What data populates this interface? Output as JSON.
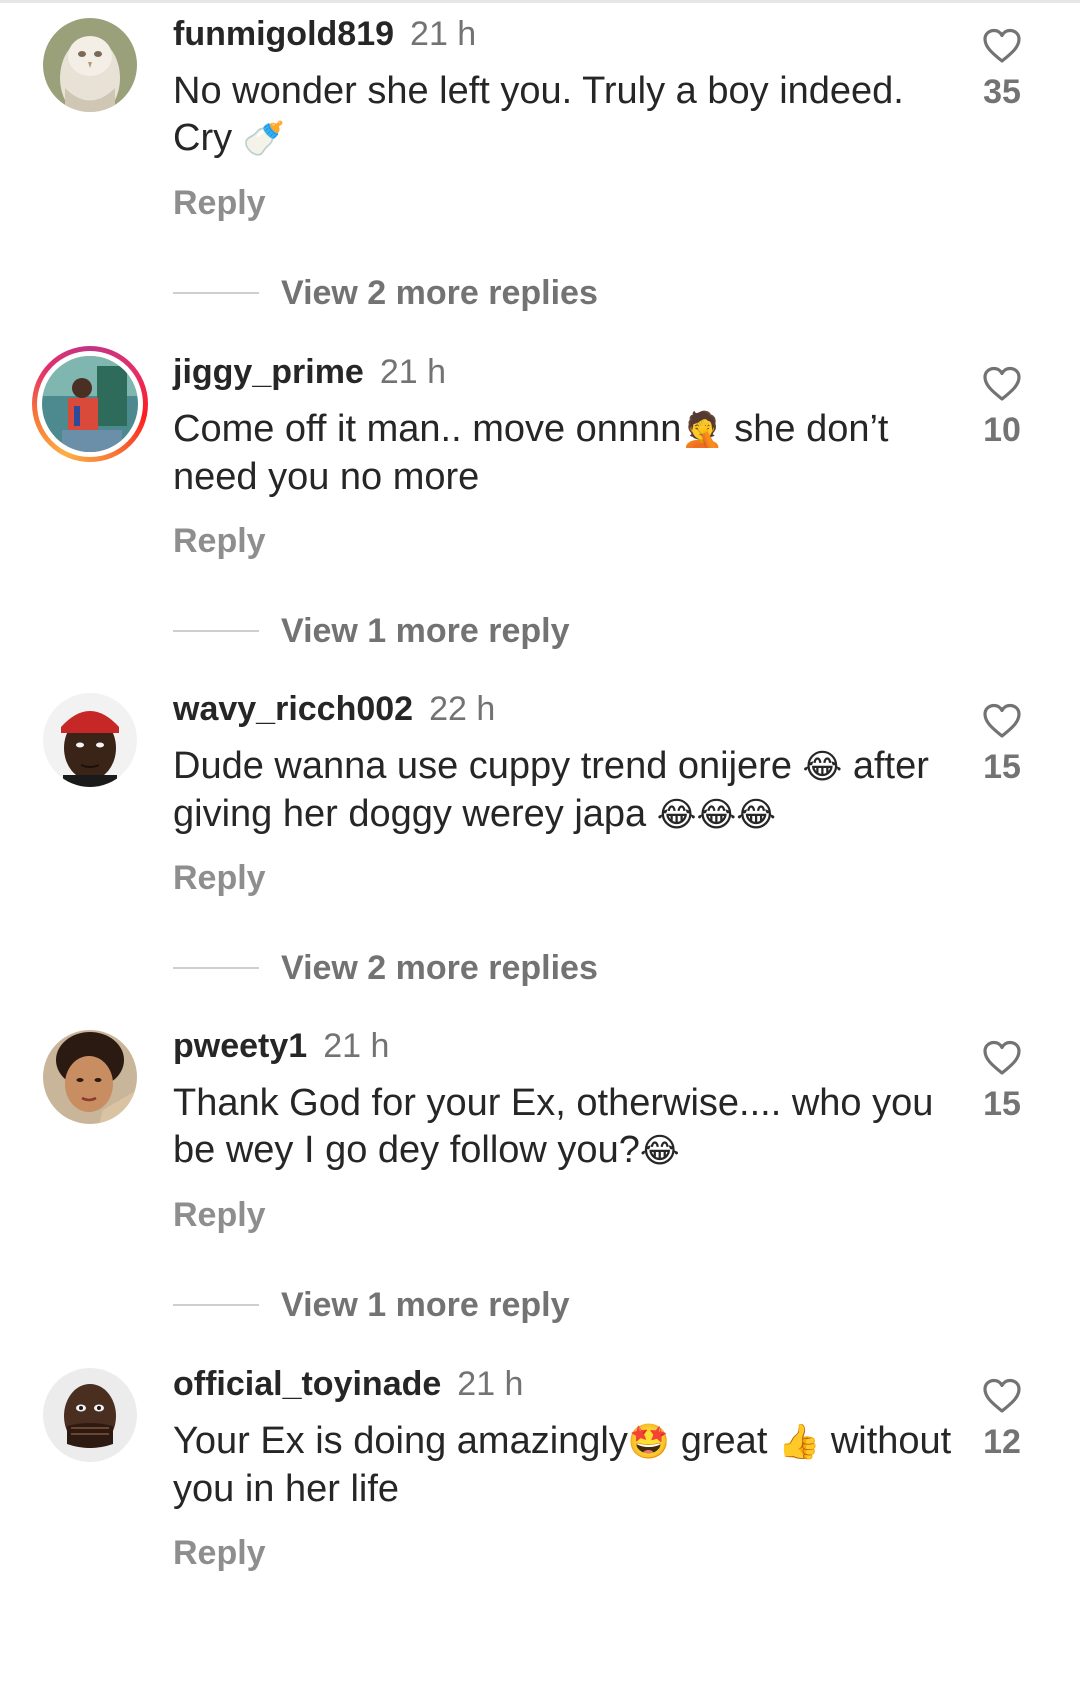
{
  "comments": [
    {
      "username": "funmigold819",
      "time": "21 h",
      "text": "No wonder she left you. Truly a boy indeed. Cry",
      "text_emoji": "🍼",
      "reply_label": "Reply",
      "view_more": "View 2 more replies",
      "likes": "35",
      "avatar": "owl-avatar",
      "has_story_ring": false
    },
    {
      "username": "jiggy_prime",
      "time": "21 h",
      "text_before": "Come off it man.. move onnnn",
      "text_emoji": "🤦",
      "text_after": " she don’t need you no more",
      "reply_label": "Reply",
      "view_more": "View 1 more reply",
      "likes": "10",
      "avatar": "person-avatar",
      "has_story_ring": true
    },
    {
      "username": "wavy_ricch002",
      "time": "22 h",
      "text_line1": "Dude wanna use cuppy trend onijere",
      "text_emoji1": "😂",
      "text_line2": "after giving her doggy werey japa",
      "text_emoji2": "😂😂😂",
      "reply_label": "Reply",
      "view_more": "View 2 more replies",
      "likes": "15",
      "avatar": "man-red-cap-avatar",
      "has_story_ring": false
    },
    {
      "username": "pweety1",
      "time": "21 h",
      "text": "Thank God for your Ex, otherwise.... who you be wey I go dey follow you?",
      "text_emoji": "😂",
      "reply_label": "Reply",
      "view_more": "View 1 more reply",
      "likes": "15",
      "avatar": "woman-avatar",
      "has_story_ring": false
    },
    {
      "username": "official_toyinade",
      "time": "21 h",
      "text_before": "Your Ex is doing amazingly",
      "text_emoji1": "🤩",
      "text_middle": " great ",
      "text_emoji2": "👍",
      "text_after": " without you in her life",
      "reply_label": "Reply",
      "likes": "12",
      "avatar": "hand-over-mouth-avatar",
      "has_story_ring": false
    }
  ],
  "colors": {
    "username": "#262626",
    "secondary_text": "#737373",
    "reply": "#8e8e8e",
    "story_ring_start": "#c13584",
    "story_ring_end": "#fcaf45"
  }
}
